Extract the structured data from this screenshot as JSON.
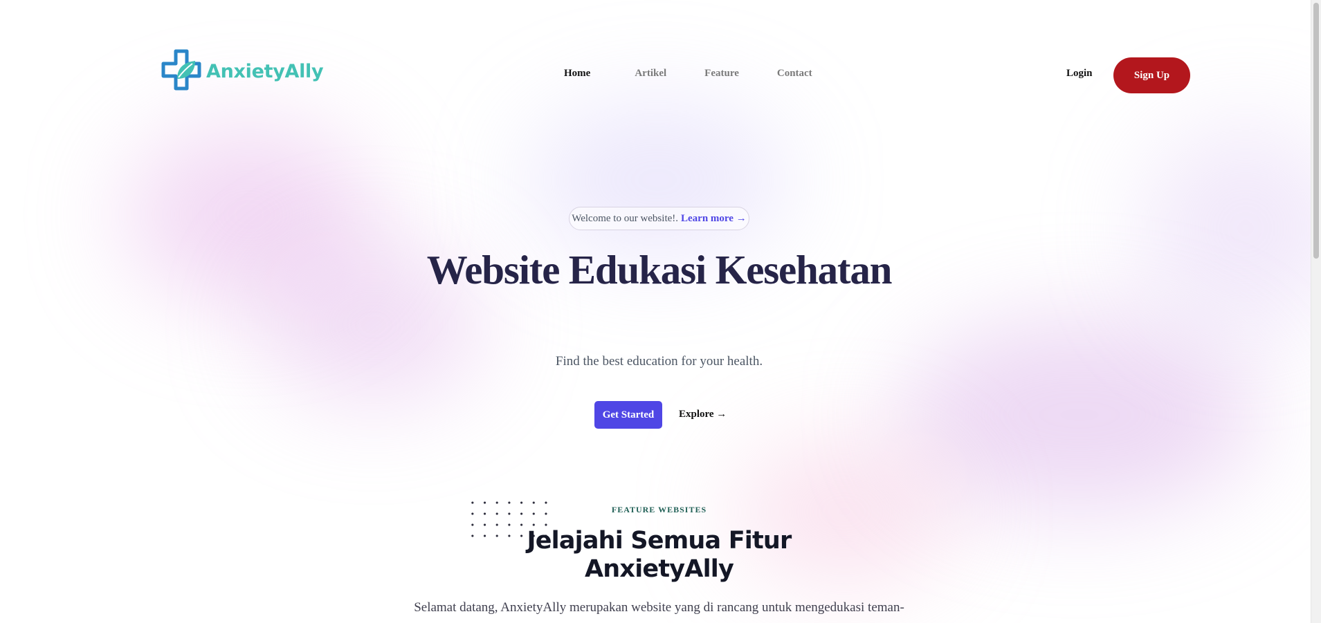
{
  "brand": {
    "name": "AnxietyAlly",
    "color": "#43c1b4",
    "icon": "medical-cross-leaf-icon"
  },
  "nav": {
    "items": [
      {
        "label": "Home",
        "active": true
      },
      {
        "label": "Artikel",
        "active": false
      },
      {
        "label": "Feature",
        "active": false
      },
      {
        "label": "Contact",
        "active": false
      }
    ],
    "login_label": "Login",
    "signup_label": "Sign Up",
    "signup_color": "#b3171d"
  },
  "hero": {
    "pill_text": "Welcome to our website!.",
    "pill_link": "Learn more →",
    "title": "Website Edukasi Kesehatan",
    "subtitle": "Find the best education for your health.",
    "primary_cta": "Get Started",
    "secondary_cta": "Explore →",
    "accent": "#4f46e5"
  },
  "features": {
    "label": "FEATURE WEBSITES",
    "title": "Jelajahi Semua Fitur AnxietyAlly",
    "body": "Selamat datang, AnxietyAlly merupakan website yang di rancang untuk mengedukasi teman-"
  }
}
